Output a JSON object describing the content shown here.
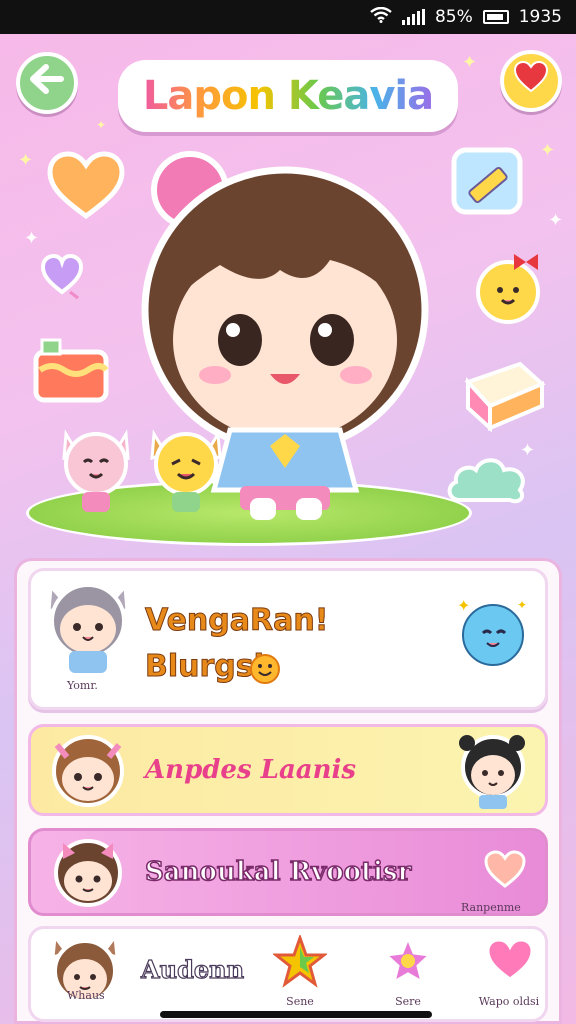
{
  "status_bar": {
    "battery": "85%",
    "time": "1935"
  },
  "header": {
    "title": "Lapon Keavia"
  },
  "cards": [
    {
      "avatar_caption": "Yomr.",
      "title_line1": "VengaRan!",
      "title_line2": "Blurgsi"
    },
    {
      "label": "Anpdes Laanis"
    },
    {
      "label": "Sanoukal Rvootisr",
      "side_caption": "Ranpenme"
    },
    {
      "label": "Audenn",
      "avatar_caption": "Whaus",
      "items": [
        {
          "label": "Sene"
        },
        {
          "label": "Sere"
        },
        {
          "label": "Wapo oldsi"
        }
      ]
    }
  ],
  "colors": {
    "accent_pink": "#f05aa0",
    "back_button": "#8fd48a",
    "fav_button": "#ffd84a",
    "panel_bg": "#fdf6fb"
  }
}
